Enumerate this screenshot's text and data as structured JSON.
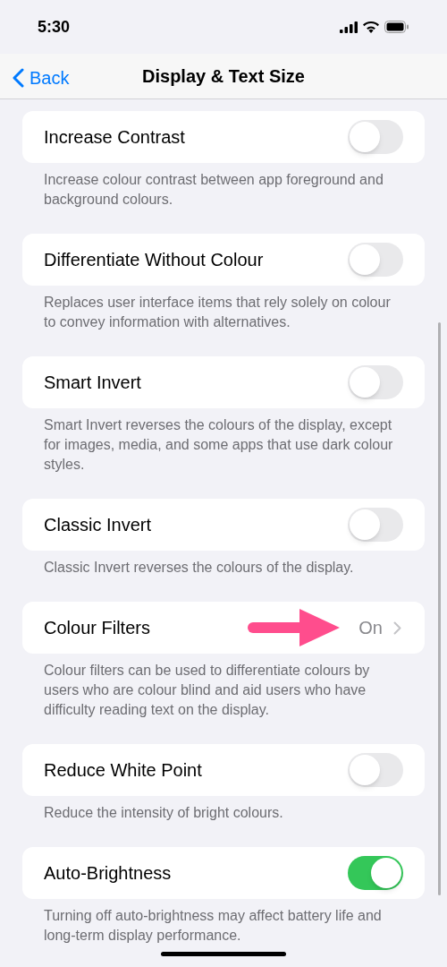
{
  "status_bar": {
    "time": "5:30"
  },
  "nav": {
    "back": "Back",
    "title": "Display & Text Size"
  },
  "settings": [
    {
      "kind": "toggle",
      "label": "Increase Contrast",
      "on": false,
      "footer": "Increase colour contrast between app foreground and background colours."
    },
    {
      "kind": "toggle",
      "label": "Differentiate Without Colour",
      "on": false,
      "footer": "Replaces user interface items that rely solely on colour to convey information with alternatives."
    },
    {
      "kind": "toggle",
      "label": "Smart Invert",
      "on": false,
      "footer": "Smart Invert reverses the colours of the display, except for images, media, and some apps that use dark colour styles."
    },
    {
      "kind": "toggle",
      "label": "Classic Invert",
      "on": false,
      "footer": "Classic Invert reverses the colours of the display."
    },
    {
      "kind": "link",
      "label": "Colour Filters",
      "value": "On",
      "annotated": true,
      "footer": "Colour filters can be used to differentiate colours by users who are colour blind and aid users who have difficulty reading text on the display."
    },
    {
      "kind": "toggle",
      "label": "Reduce White Point",
      "on": false,
      "footer": "Reduce the intensity of bright colours."
    },
    {
      "kind": "toggle",
      "label": "Auto-Brightness",
      "on": true,
      "footer": "Turning off auto-brightness may affect battery life and long-term display performance."
    }
  ]
}
